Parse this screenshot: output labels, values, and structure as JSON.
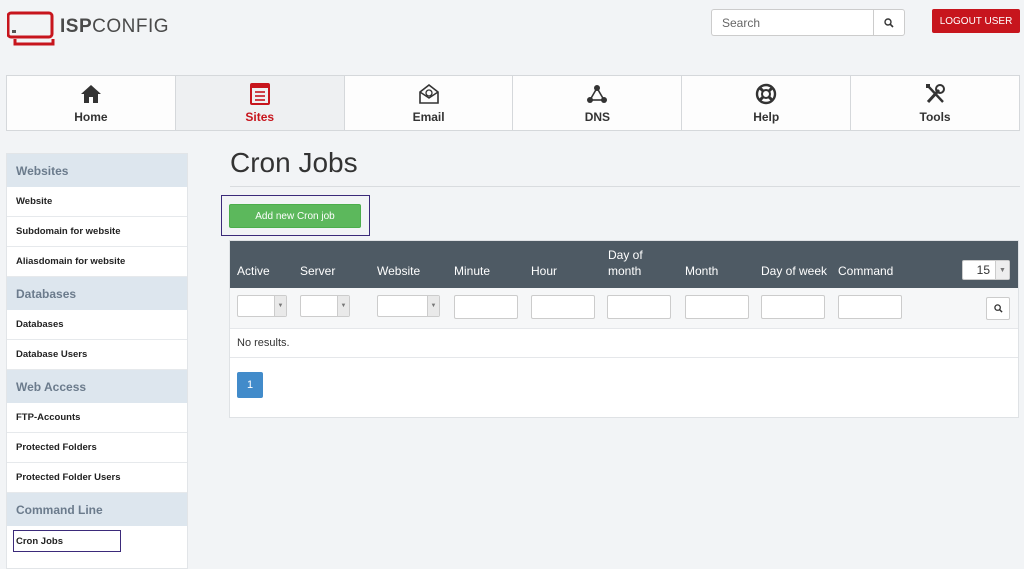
{
  "header": {
    "logo_text_bold": "ISP",
    "logo_text_light": "CONFIG",
    "search_placeholder": "Search",
    "logout_label": "LOGOUT USER",
    "brand_color": "#c7151d"
  },
  "nav": {
    "tabs": [
      {
        "label": "Home",
        "icon": "home-icon",
        "active": false
      },
      {
        "label": "Sites",
        "icon": "sites-icon",
        "active": true
      },
      {
        "label": "Email",
        "icon": "email-icon",
        "active": false
      },
      {
        "label": "DNS",
        "icon": "dns-icon",
        "active": false
      },
      {
        "label": "Help",
        "icon": "help-icon",
        "active": false
      },
      {
        "label": "Tools",
        "icon": "tools-icon",
        "active": false
      }
    ]
  },
  "sidebar": {
    "sections": [
      {
        "title": "Websites",
        "items": [
          "Website",
          "Subdomain for website",
          "Aliasdomain for website"
        ]
      },
      {
        "title": "Databases",
        "items": [
          "Databases",
          "Database Users"
        ]
      },
      {
        "title": "Web Access",
        "items": [
          "FTP-Accounts",
          "Protected Folders",
          "Protected Folder Users"
        ]
      },
      {
        "title": "Command Line",
        "items": [
          "Cron Jobs"
        ]
      }
    ],
    "selected_item": "Cron Jobs"
  },
  "main": {
    "title": "Cron Jobs",
    "add_button_label": "Add new Cron job",
    "columns": [
      "Active",
      "Server",
      "Website",
      "Minute",
      "Hour",
      "Day of month",
      "Month",
      "Day of week",
      "Command"
    ],
    "rows_per_page": "15",
    "no_results_text": "No results.",
    "current_page": "1"
  }
}
